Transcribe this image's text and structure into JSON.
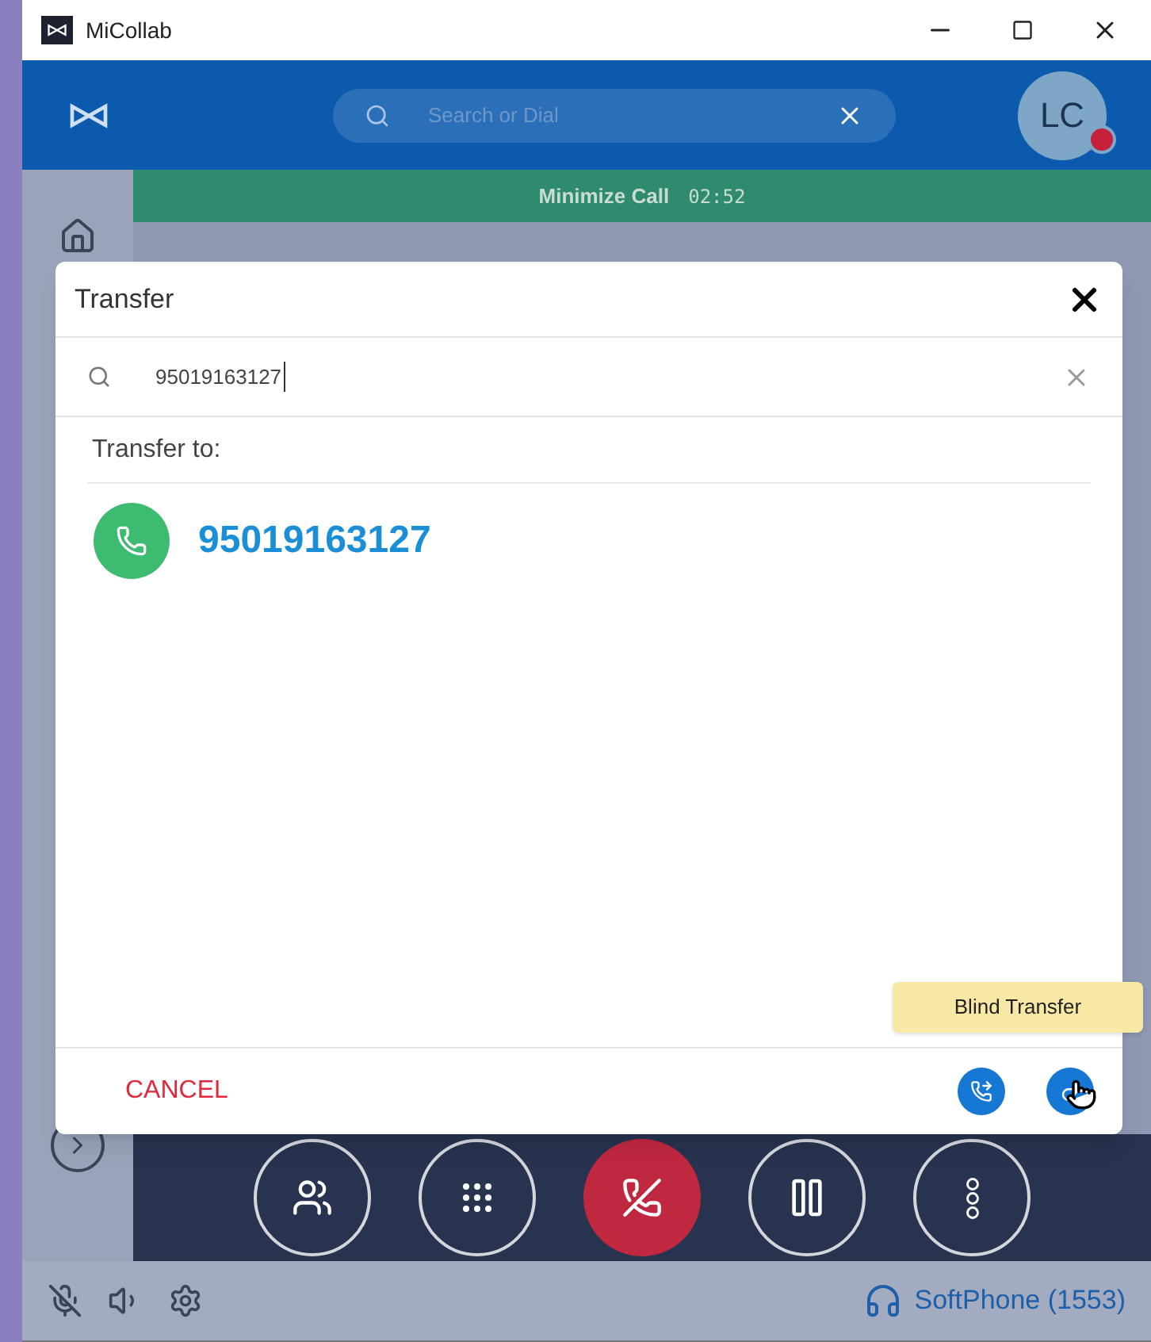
{
  "window": {
    "title": "MiCollab"
  },
  "header": {
    "search_placeholder": "Search or Dial",
    "avatar": "LC"
  },
  "call_bar": {
    "label": "Minimize Call",
    "timer": "02:52"
  },
  "dialog": {
    "title": "Transfer",
    "search_value": "95019163127",
    "section_label": "Transfer to:",
    "results": [
      {
        "number": "95019163127"
      }
    ],
    "cancel": "CANCEL",
    "tooltip": "Blind Transfer"
  },
  "controls": [
    {
      "kind": "conference"
    },
    {
      "kind": "dialpad"
    },
    {
      "kind": "hangup"
    },
    {
      "kind": "hold"
    },
    {
      "kind": "more"
    }
  ],
  "status_bar": {
    "device": "SoftPhone (1553)"
  }
}
